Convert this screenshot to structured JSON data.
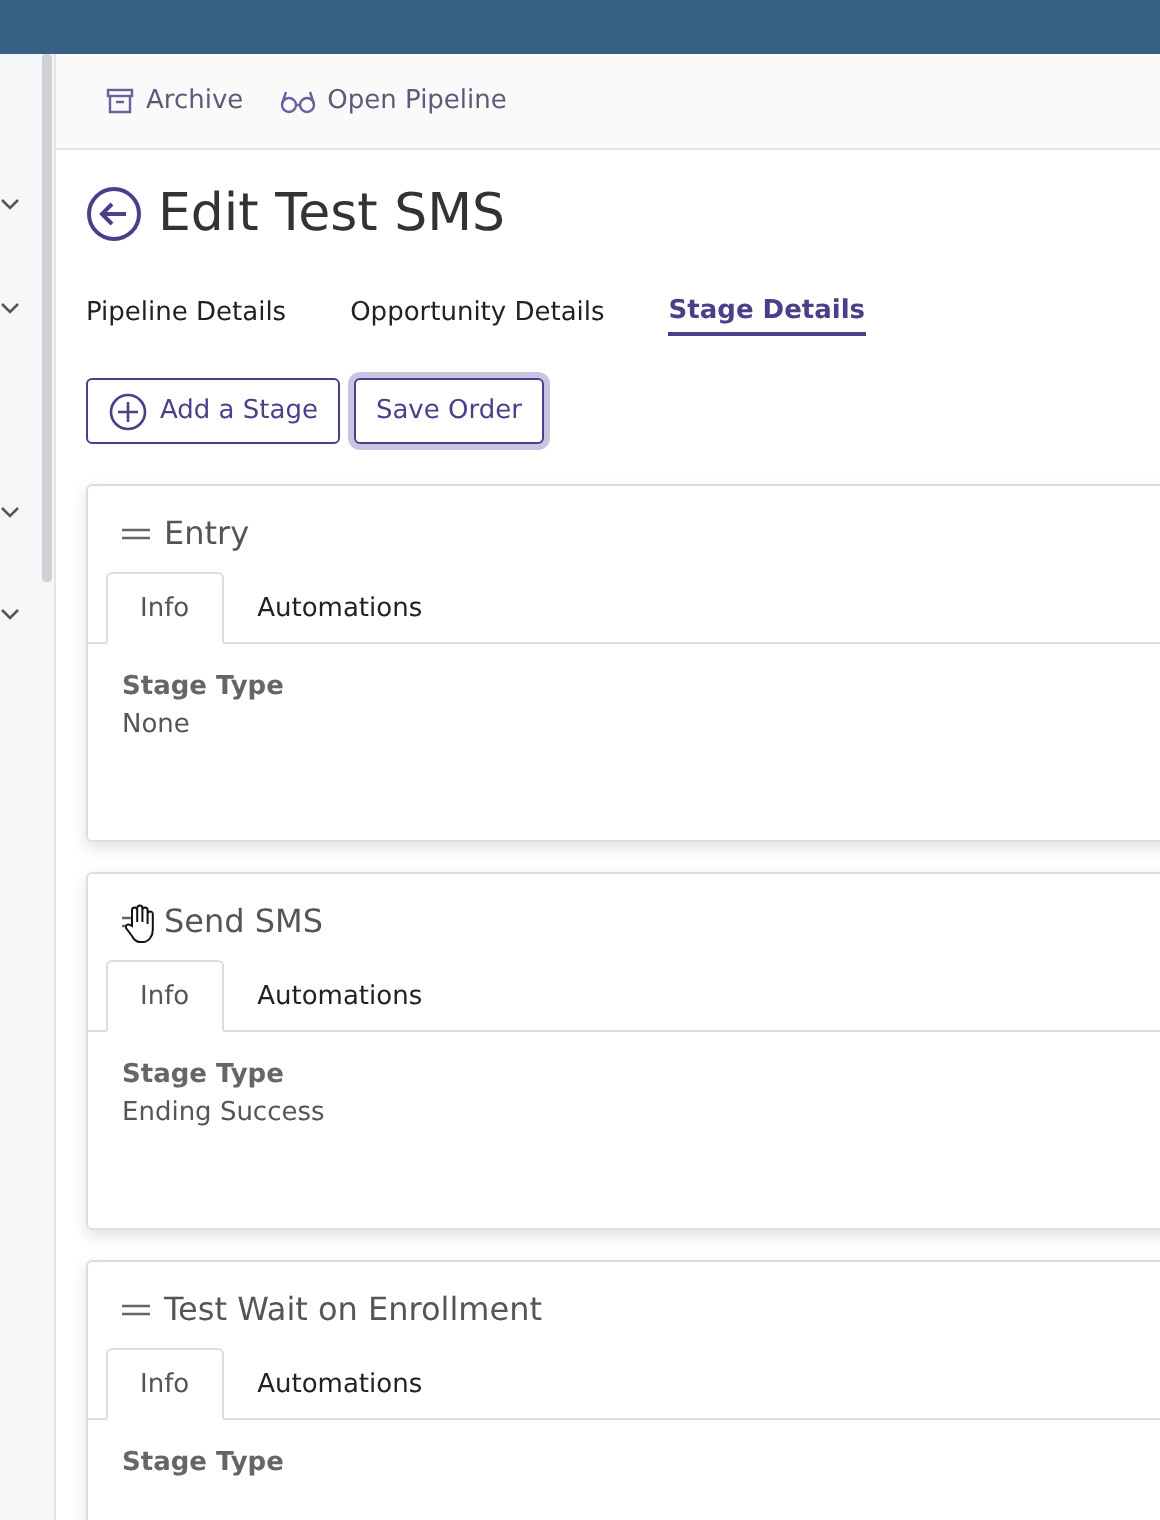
{
  "toolbar": [
    {
      "kind": "archive",
      "label": "Archive"
    },
    {
      "kind": "glasses",
      "label": "Open Pipeline"
    }
  ],
  "title": "Edit Test SMS",
  "tabs": [
    {
      "label": "Pipeline Details",
      "selected": false
    },
    {
      "label": "Opportunity Details",
      "selected": false
    },
    {
      "label": "Stage Details",
      "selected": true
    }
  ],
  "buttons": [
    {
      "kind": "add",
      "label": "Add a Stage",
      "focused": false
    },
    {
      "kind": "plain",
      "label": "Save Order",
      "focused": true
    }
  ],
  "stages": [
    {
      "name": "Entry",
      "hand_cursor": false,
      "tabs": [
        {
          "label": "Info",
          "selected": true
        },
        {
          "label": "Automations",
          "selected": false
        }
      ],
      "field_label": "Stage Type",
      "field_value": "None"
    },
    {
      "name": "Send SMS",
      "hand_cursor": true,
      "tabs": [
        {
          "label": "Info",
          "selected": true
        },
        {
          "label": "Automations",
          "selected": false
        }
      ],
      "field_label": "Stage Type",
      "field_value": "Ending Success"
    },
    {
      "name": "Test Wait on Enrollment",
      "hand_cursor": false,
      "tabs": [
        {
          "label": "Info",
          "selected": true
        },
        {
          "label": "Automations",
          "selected": false
        }
      ],
      "field_label": "Stage Type"
    }
  ]
}
